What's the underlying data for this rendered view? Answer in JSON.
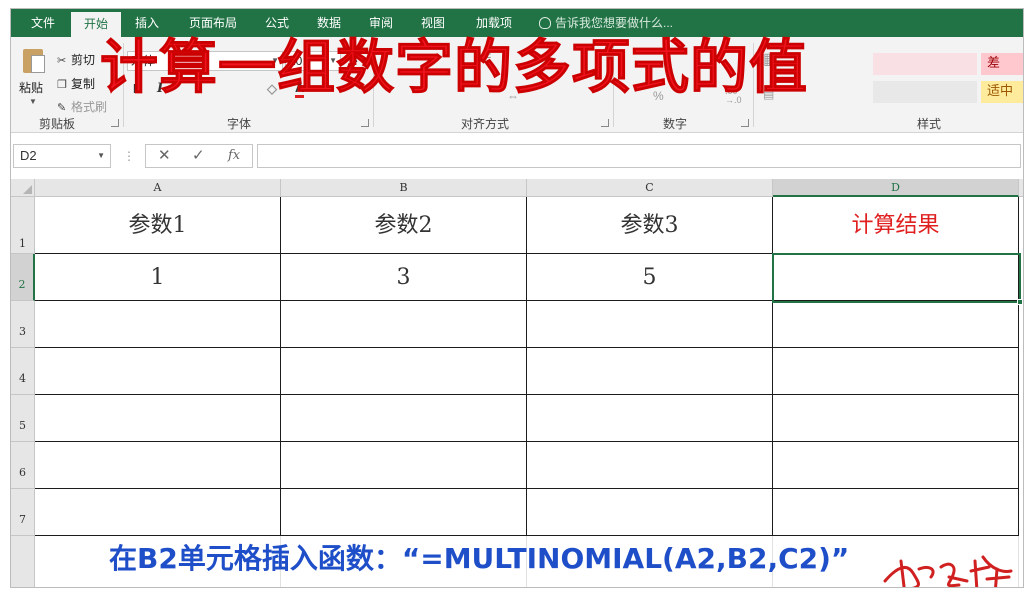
{
  "ribbon_tabs": {
    "file": "文件",
    "home": "开始",
    "insert": "插入",
    "page_layout": "页面布局",
    "formulas": "公式",
    "data": "数据",
    "review": "审阅",
    "view": "视图",
    "addins": "加载项"
  },
  "tell_me": "告诉我您想要做什么...",
  "clipboard": {
    "paste": "粘贴",
    "cut": "剪切",
    "copy": "复制",
    "format_painter": "格式刷",
    "group_label": "剪贴板"
  },
  "font": {
    "name": "宋体",
    "size": "20",
    "bold": "B",
    "italic": "I",
    "font_color": "A",
    "group_label": "字体"
  },
  "alignment": {
    "group_label": "对齐方式"
  },
  "number": {
    "group_label": "数字"
  },
  "styles": {
    "group_label": "样式",
    "bad": "差",
    "neutral": "适中",
    "bad_color": "#ffc7ce",
    "neutral_color": "#ffeb9c"
  },
  "formula_bar": {
    "name_box": "D2",
    "cancel": "✕",
    "enter": "✓",
    "fx": "fx",
    "content": ""
  },
  "sheet": {
    "columns": [
      "A",
      "B",
      "C",
      "D"
    ],
    "rows": [
      "1",
      "2",
      "3",
      "4",
      "5",
      "6",
      "7"
    ],
    "header_row": [
      "参数1",
      "参数2",
      "参数3",
      "计算结果"
    ],
    "value_row": [
      "1",
      "3",
      "5",
      ""
    ],
    "active_cell": "D2",
    "accent_color": "#217346",
    "result_header_color": "#e02020"
  },
  "overlay": {
    "title": "计算一组数字的多项式的值",
    "caption": "在B2单元格插入函数：“=MULTINOMIAL(A2,B2,C2)”",
    "title_color": "#f0141e",
    "caption_color": "#1e4ec8"
  }
}
